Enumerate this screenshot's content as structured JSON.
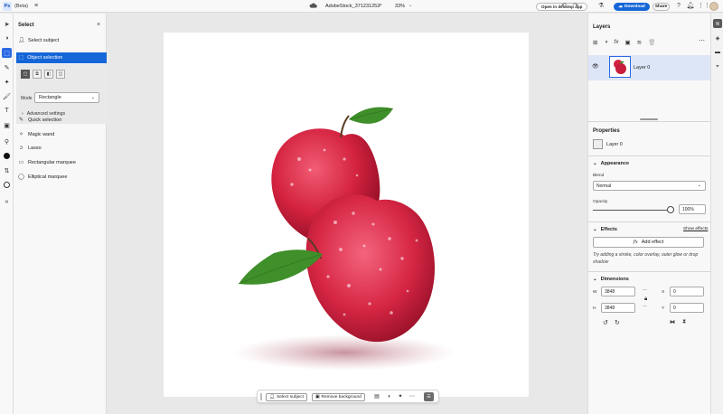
{
  "topbar": {
    "app_badge": "Ps",
    "beta_label": "(Beta)",
    "doc_title": "AdobeStock_371231252*",
    "zoom": "33%",
    "open_desktop": "Open in desktop app",
    "download": "Download",
    "share": "Share"
  },
  "select_panel": {
    "title": "Select",
    "select_subject": "Select subject",
    "object_selection": "Object selection",
    "mode_label": "Mode",
    "mode_value": "Rectangle",
    "advanced": "Advanced settings",
    "tools": [
      "Quick selection",
      "Magic wand",
      "Lasso",
      "Rectangular marquee",
      "Elliptical marquee"
    ]
  },
  "float_bar": {
    "select_subject": "Select subject",
    "remove_background": "Remove background"
  },
  "layers": {
    "title": "Layers",
    "layer_name": "Layer 0"
  },
  "properties": {
    "title": "Properties",
    "layer_name": "Layer 0",
    "appearance": "Appearance",
    "blend_label": "Blend",
    "blend_value": "Normal",
    "opacity_label": "Opacity",
    "opacity_value": "100%",
    "effects": "Effects",
    "show_effects": "Show effects",
    "add_effect": "Add effect",
    "fx": "fx",
    "hint": "Try adding a stroke, color overlay, outer glow or drop shadow",
    "dimensions": "Dimensions",
    "w_label": "W",
    "h_label": "H",
    "x_label": "X",
    "y_label": "Y",
    "w_value": "3848",
    "h_value": "3848",
    "x_value": "0",
    "y_value": "0"
  },
  "colors": {
    "accent": "#1566d7",
    "apple": "#d8284a",
    "leaf": "#3f8f2a"
  }
}
